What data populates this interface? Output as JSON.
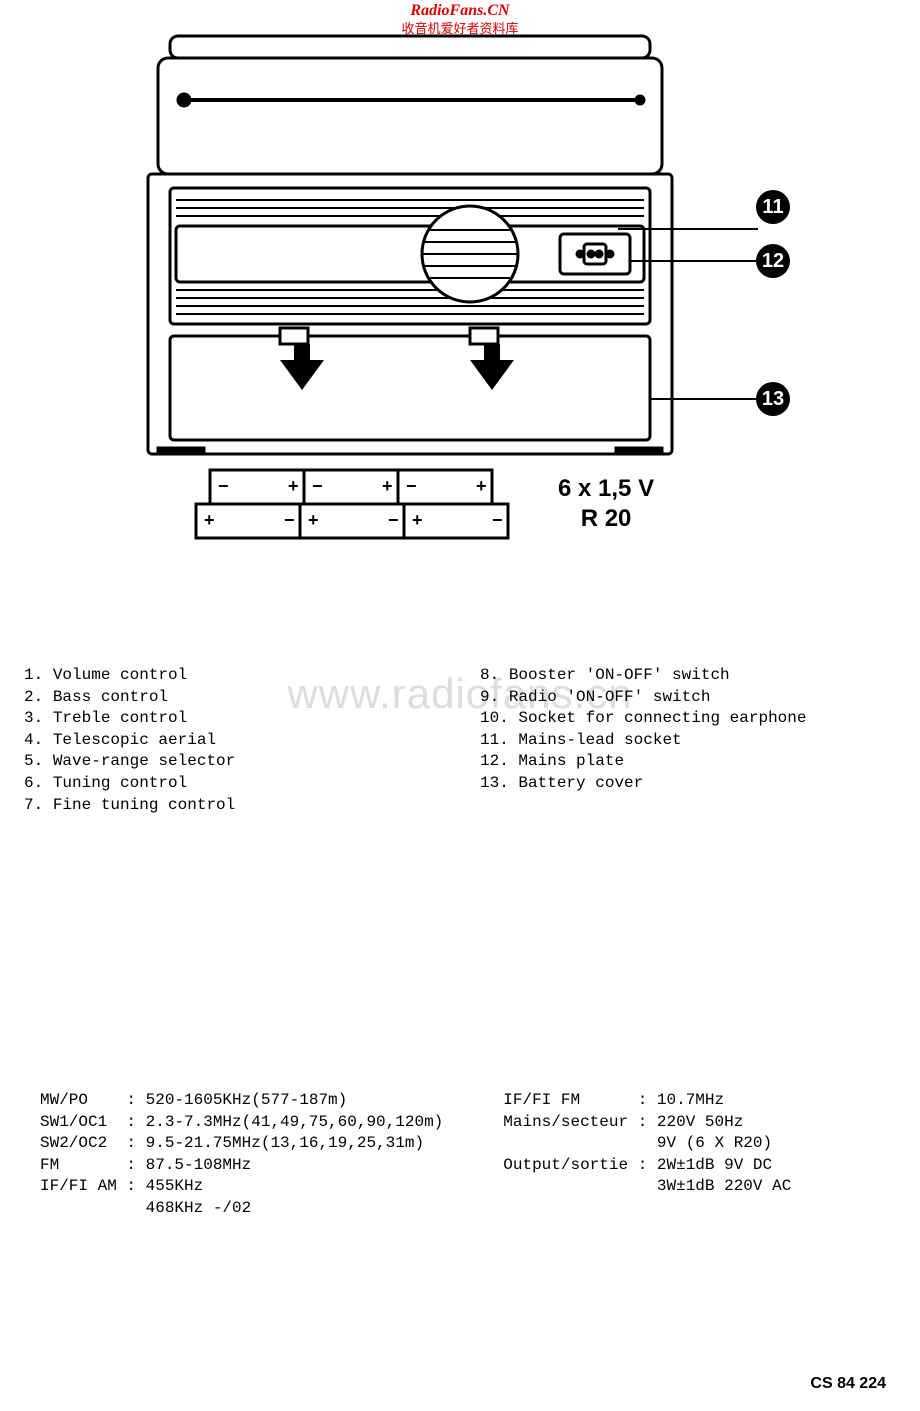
{
  "watermark": {
    "site": "RadioFans.CN",
    "subtitle": "收音机爱好者资料库",
    "body": "www.radiofans.cn"
  },
  "diagram": {
    "callouts": {
      "c11": "11",
      "c12": "12",
      "c13": "13"
    },
    "battery_label_line1": "6 x 1,5 V",
    "battery_label_line2": "R 20"
  },
  "legend": {
    "left": [
      {
        "n": "1.",
        "t": "Volume control"
      },
      {
        "n": "2.",
        "t": "Bass control"
      },
      {
        "n": "3.",
        "t": "Treble control"
      },
      {
        "n": "4.",
        "t": "Telescopic aerial"
      },
      {
        "n": "5.",
        "t": "Wave-range selector"
      },
      {
        "n": "6.",
        "t": "Tuning control"
      },
      {
        "n": "7.",
        "t": "Fine tuning control"
      }
    ],
    "right": [
      {
        "n": "8.",
        "t": "Booster 'ON-OFF' switch"
      },
      {
        "n": "9.",
        "t": "Radio 'ON-OFF' switch"
      },
      {
        "n": "10.",
        "t": "Socket for connecting earphone"
      },
      {
        "n": "11.",
        "t": "Mains-lead socket"
      },
      {
        "n": "12.",
        "t": "Mains plate"
      },
      {
        "n": "13.",
        "t": "Battery cover"
      }
    ]
  },
  "specs": {
    "left": [
      "MW/PO    : 520-1605KHz(577-187m)",
      "SW1/OC1  : 2.3-7.3MHz(41,49,75,60,90,120m)",
      "SW2/OC2  : 9.5-21.75MHz(13,16,19,25,31m)",
      "FM       : 87.5-108MHz",
      "IF/FI AM : 455KHz",
      "           468KHz -/02"
    ],
    "right": [
      "IF/FI FM      : 10.7MHz",
      "Mains/secteur : 220V 50Hz",
      "                9V (6 X R20)",
      "Output/sortie : 2W±1dB 9V DC",
      "                3W±1dB 220V AC"
    ]
  },
  "footer": "CS 84 224"
}
